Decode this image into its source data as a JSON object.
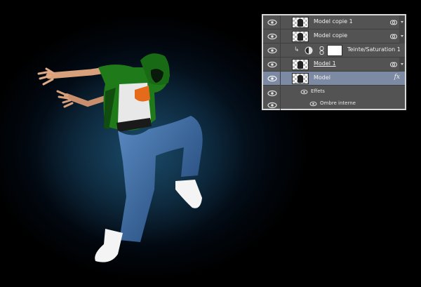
{
  "layers_panel": {
    "layers": [
      {
        "name": "Model copie 1",
        "type": "pixel",
        "selected": false
      },
      {
        "name": "Model copie",
        "type": "pixel",
        "selected": false
      },
      {
        "name": "Teinte/Saturation 1",
        "type": "adjustment",
        "selected": false
      },
      {
        "name": "Model 1",
        "type": "pixel",
        "selected": false
      },
      {
        "name": "Model",
        "type": "pixel",
        "selected": true,
        "fx": "fx"
      }
    ],
    "effects_label": "Effets",
    "effect_items": [
      "Ombre interne"
    ]
  },
  "colors": {
    "panel_bg": "#535353",
    "panel_border": "#d8d8d8",
    "selected_row": "#7d8aa3",
    "hoodie": "#1f7a1a",
    "jeans": "#2d5f9a"
  },
  "icons": [
    "eye-icon",
    "link-icon",
    "fx-icon",
    "adjustment-icon",
    "chain-icon",
    "clip-arrow-icon"
  ]
}
